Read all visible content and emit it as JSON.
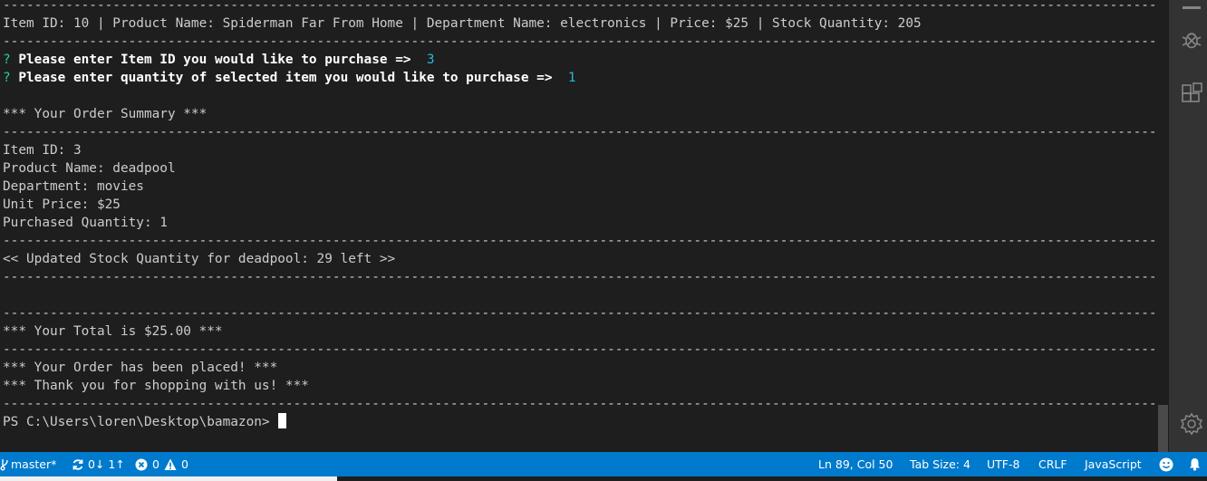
{
  "terminal": {
    "lines": [
      "---------------------------------------------------------------------------------------------------------------------------------------------------------------",
      "Item ID: 10 | Product Name: Spiderman Far From Home | Department Name: electronics | Price: $25 | Stock Quantity: 205",
      "---------------------------------------------------------------------------------------------------------------------------------------------------------------",
      "",
      "",
      "---------------------------------------------------------------------------------------------------------------------------------------------------------------",
      "",
      "",
      "*** Your Order Summary ***",
      "---------------------------------------------------------------------------------------------------------------------------------------------------------------",
      "Item ID: 3",
      "Product Name: deadpool",
      "Department: movies",
      "Unit Price: $25",
      "Purchased Quantity: 1",
      "---------------------------------------------------------------------------------------------------------------------------------------------------------------",
      "<< Updated Stock Quantity for deadpool: 29 left >>",
      "---------------------------------------------------------------------------------------------------------------------------------------------------------------",
      "",
      "---------------------------------------------------------------------------------------------------------------------------------------------------------------",
      "*** Your Total is $25.00 ***",
      "---------------------------------------------------------------------------------------------------------------------------------------------------------------",
      "*** Your Order has been placed! ***",
      "*** Thank you for shopping with us! ***",
      "---------------------------------------------------------------------------------------------------------------------------------------------------------------",
      "PS C:\\Users\\loren\\Desktop\\bamazon> "
    ],
    "prompt_marker": "?",
    "prompt1_question": "Please enter Item ID you would like to purchase =>",
    "prompt1_answer": "3",
    "prompt2_question": "Please enter quantity of selected item you would like to purchase =>",
    "prompt2_answer": "1"
  },
  "statusbar": {
    "branch": "master*",
    "sync": "0↓ 1↑",
    "errors": "0",
    "warnings": "0",
    "position": "Ln 89, Col 50",
    "tab_size": "Tab Size: 4",
    "encoding": "UTF-8",
    "eol": "CRLF",
    "language": "JavaScript"
  },
  "colors": {
    "terminal_bg": "#1e1e1e",
    "terminal_fg": "#cccccc",
    "prompt_marker": "#23d18b",
    "prompt_answer": "#29b8db",
    "statusbar_bg": "#007acc",
    "activity_bar_bg": "#333333"
  },
  "icons": [
    "git-branch-icon",
    "sync-icon",
    "error-icon",
    "warning-icon",
    "smiley-feedback-icon",
    "bell-icon",
    "debug-icon",
    "extensions-icon",
    "gear-icon"
  ]
}
